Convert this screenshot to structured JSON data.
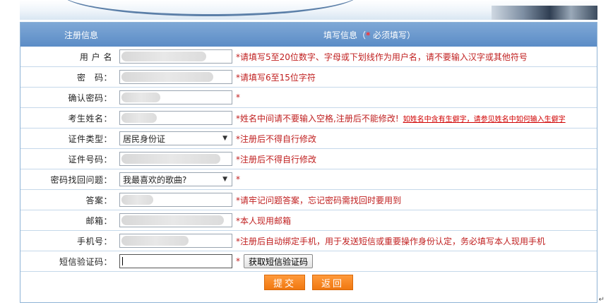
{
  "header": {
    "col1": "注册信息",
    "col2_prefix": "填写信息（",
    "col2_star": "*",
    "col2_suffix": " 必须填写）"
  },
  "fields": [
    {
      "label": "用 户 名",
      "type": "input",
      "hint": "*请填写5至20位数字、字母或下划线作为用户名，请不要输入汉字或其他符号"
    },
    {
      "label": "密　码：",
      "type": "input",
      "hint": "*请填写6至15位字符"
    },
    {
      "label": "确认密码：",
      "type": "input",
      "hint": "*"
    },
    {
      "label": "考生姓名：",
      "type": "input",
      "hint": "*姓名中间请不要输入空格,注册后不能修改!",
      "link": "如姓名中含有生僻字，请参见姓名中如何输入生僻字"
    },
    {
      "label": "证件类型：",
      "type": "select",
      "value": "居民身份证",
      "hint": "*注册后不得自行修改"
    },
    {
      "label": "证件号码：",
      "type": "input",
      "hint": "*注册后不得自行修改"
    },
    {
      "label": "密码找回问题：",
      "type": "select",
      "value": "我最喜欢的歌曲?",
      "hint": "*"
    },
    {
      "label": "答案：",
      "type": "input",
      "hint": "*请牢记问题答案，忘记密码需找回时要用到"
    },
    {
      "label": "邮箱：",
      "type": "input",
      "hint": "*本人现用邮箱"
    },
    {
      "label": "手机号：",
      "type": "input",
      "hint": "*注册后自动绑定手机，用于发送短信或重要操作身份认定，务必填写本人现用手机"
    },
    {
      "label": "短信验证码：",
      "type": "input",
      "hint": "*",
      "button": "获取短信验证码"
    }
  ],
  "buttons": {
    "submit": "提交",
    "back": "返回"
  },
  "colors": {
    "header": "#5b8cc6",
    "hint": "#c02020",
    "button": "#f07810"
  }
}
